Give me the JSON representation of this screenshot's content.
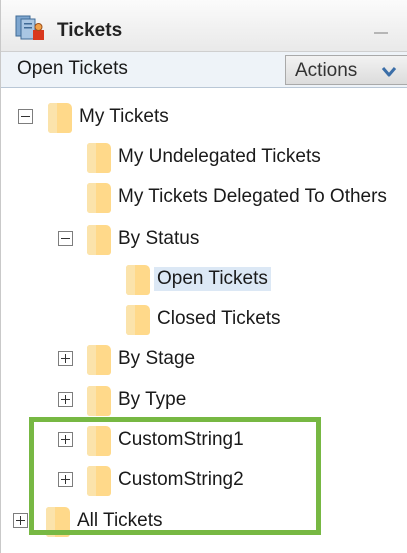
{
  "panel": {
    "title": "Tickets",
    "title_icon": "tickets-icon",
    "minimize_icon": "minimize-icon"
  },
  "subbar": {
    "view_label": "Open Tickets",
    "actions_label": "Actions",
    "actions_icon": "chevron-down-icon"
  },
  "tree": {
    "my_tickets": {
      "label": "My Tickets",
      "expanded": true
    },
    "my_undelegated": {
      "label": "My Undelegated Tickets"
    },
    "my_delegated": {
      "label": "My Tickets Delegated To Others"
    },
    "by_status": {
      "label": "By Status",
      "expanded": true
    },
    "open_tickets": {
      "label": "Open Tickets",
      "selected": true
    },
    "closed_tickets": {
      "label": "Closed Tickets"
    },
    "by_stage": {
      "label": "By Stage",
      "expanded": false
    },
    "by_type": {
      "label": "By Type",
      "expanded": false
    },
    "custom_string_1": {
      "label": "CustomString1",
      "expanded": false
    },
    "custom_string_2": {
      "label": "CustomString2",
      "expanded": false
    },
    "all_tickets": {
      "label": "All Tickets",
      "expanded": false
    }
  },
  "colors": {
    "highlight_border": "#77b843",
    "folder": "#ffd98a",
    "selection": "#dce8f5"
  }
}
